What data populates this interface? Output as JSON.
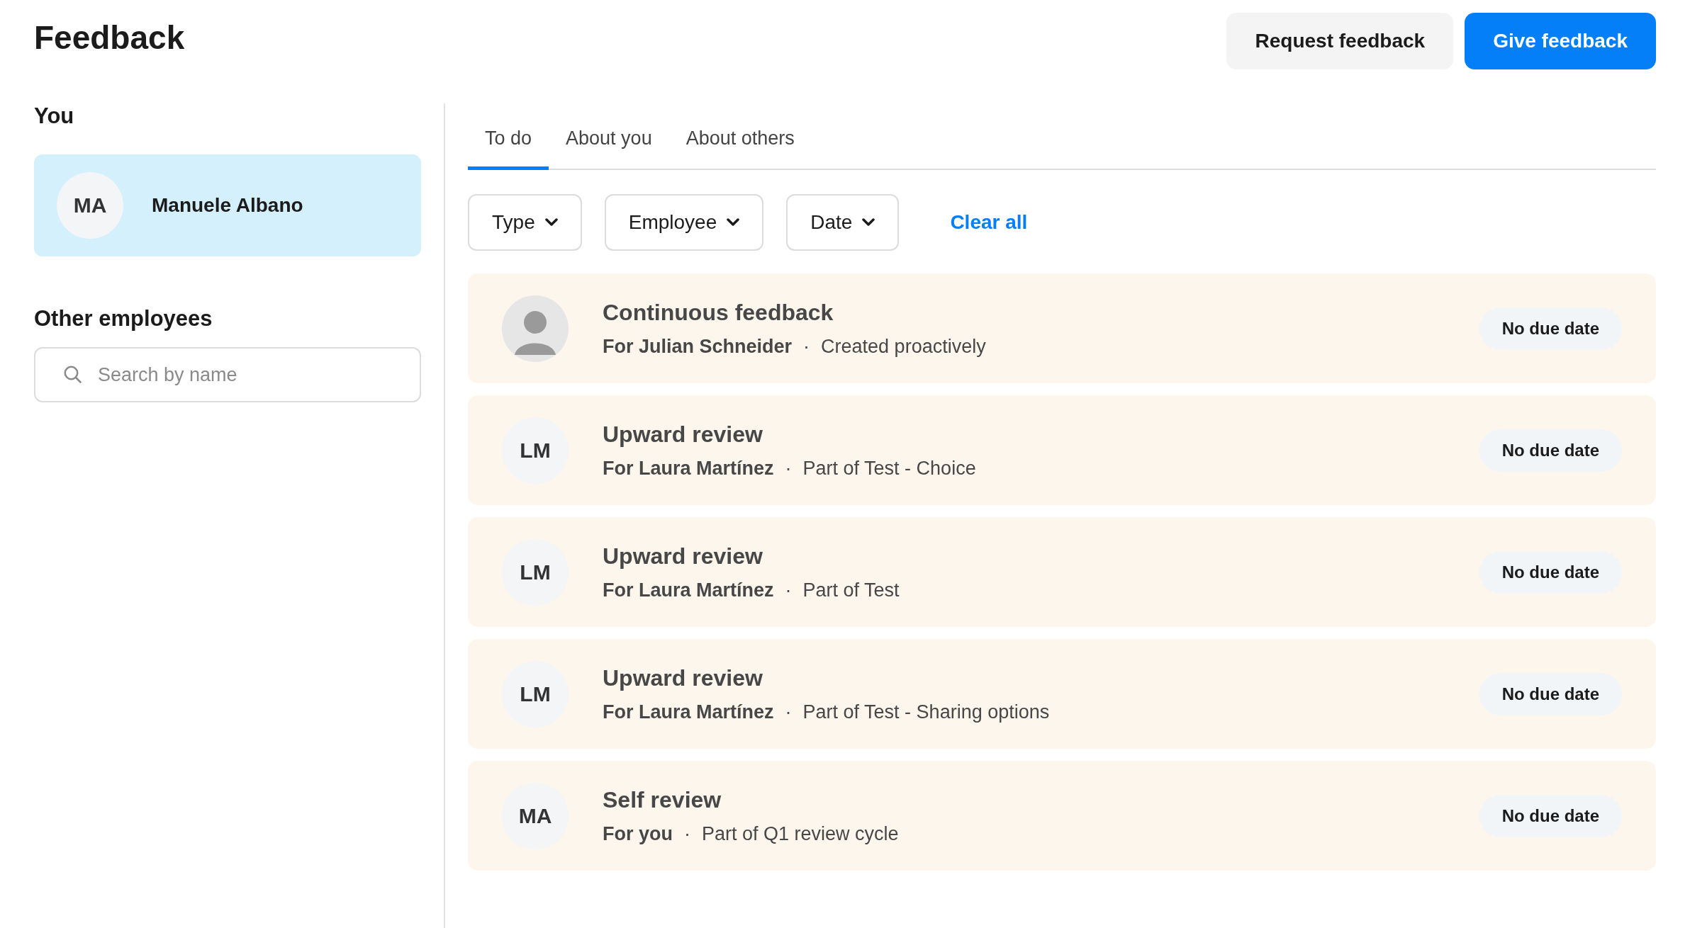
{
  "header": {
    "title": "Feedback",
    "buttons": [
      {
        "label": "Request feedback",
        "kind": "secondary"
      },
      {
        "label": "Give feedback",
        "kind": "primary"
      }
    ]
  },
  "sidebar": {
    "you_heading": "You",
    "you": {
      "initials": "MA",
      "name": "Manuele Albano",
      "selected": true
    },
    "others_heading": "Other employees",
    "search": {
      "placeholder": "Search by name"
    }
  },
  "tabs": [
    {
      "label": "To do",
      "selected": true
    },
    {
      "label": "About you",
      "selected": false
    },
    {
      "label": "About others",
      "selected": false
    }
  ],
  "filters": [
    {
      "label": "Type"
    },
    {
      "label": "Employee"
    },
    {
      "label": "Date"
    }
  ],
  "clear_all": "Clear all",
  "items": [
    {
      "avatar": {
        "kind": "photo"
      },
      "title": "Continuous feedback",
      "for": "For Julian Schneider",
      "separator": "·",
      "context": "Created proactively",
      "badge": "No due date"
    },
    {
      "avatar": {
        "kind": "initials",
        "initials": "LM"
      },
      "title": "Upward review",
      "for": "For Laura Martínez",
      "separator": "·",
      "context": "Part of Test - Choice",
      "badge": "No due date"
    },
    {
      "avatar": {
        "kind": "initials",
        "initials": "LM"
      },
      "title": "Upward review",
      "for": "For Laura Martínez",
      "separator": "·",
      "context": "Part of Test",
      "badge": "No due date"
    },
    {
      "avatar": {
        "kind": "initials",
        "initials": "LM"
      },
      "title": "Upward review",
      "for": "For Laura Martínez",
      "separator": "·",
      "context": "Part of Test - Sharing options",
      "badge": "No due date"
    },
    {
      "avatar": {
        "kind": "initials",
        "initials": "MA"
      },
      "title": "Self review",
      "for": "For you",
      "separator": "·",
      "context": "Part of Q1 review cycle",
      "badge": "No due date"
    }
  ]
}
